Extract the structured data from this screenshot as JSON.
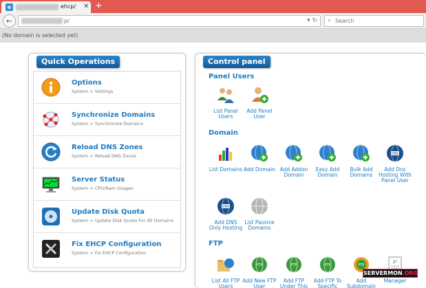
{
  "browser": {
    "tab_title": "ehcp/",
    "url_text": "p/",
    "search_placeholder": "Search"
  },
  "domain_status": "(No domain is selected yet)",
  "quick_operations": {
    "title": "Quick Operations",
    "items": [
      {
        "name": "Options",
        "path": "System > Settings",
        "icon": "options-info-icon"
      },
      {
        "name": "Synchronize Domains",
        "path": "System > Synchronize Domains",
        "icon": "network-sync-icon"
      },
      {
        "name": "Reload DNS Zones",
        "path": "System > Reload DNS Zones",
        "icon": "reload-icon"
      },
      {
        "name": "Server Status",
        "path": "System > CPU/Ram Usages",
        "icon": "monitor-icon"
      },
      {
        "name": "Update Disk Quota",
        "path": "System > Update Disk Quota For All Domains",
        "icon": "disk-icon"
      },
      {
        "name": "Fix EHCP Configuration",
        "path": "System > Fix EHCP Configuration",
        "icon": "tools-icon"
      }
    ]
  },
  "control_panel": {
    "title": "Control panel",
    "sections": {
      "panel_users": {
        "label": "Panel Users",
        "items": [
          {
            "label": "List Panel Users",
            "icon": "users-icon"
          },
          {
            "label": "Add Panel User",
            "icon": "add-user-icon"
          }
        ]
      },
      "domain": {
        "label": "Domain",
        "items": [
          {
            "label": "List Domains",
            "icon": "bar-chart-icon"
          },
          {
            "label": "Add Domain",
            "icon": "globe-add-icon"
          },
          {
            "label": "Add Addon Domain",
            "icon": "globe-add-icon"
          },
          {
            "label": "Easy Add Domain",
            "icon": "globe-add-icon"
          },
          {
            "label": "Bulk Add Domains",
            "icon": "globe-add-icon"
          },
          {
            "label": "Add Dns Hosting With Panel User",
            "icon": "dns-globe-icon"
          },
          {
            "label": "Add DNS Only Hosting",
            "icon": "dns-globe-icon"
          },
          {
            "label": "List Passive Domains",
            "icon": "grey-globe-icon"
          }
        ]
      },
      "ftp": {
        "label": "FTP",
        "items": [
          {
            "label": "List All FTP Users",
            "icon": "folder-globe-icon"
          },
          {
            "label": "Add New FTP User",
            "icon": "ftp-globe-icon"
          },
          {
            "label": "Add FTP Under This Panel",
            "icon": "ftp-globe-icon"
          },
          {
            "label": "Add FTP To Specific Domain",
            "icon": "ftp-globe-icon"
          },
          {
            "label": "Add Subdomain With FTP",
            "icon": "ftp-globe-icon"
          },
          {
            "label": "Manager",
            "icon": "doc-icon"
          }
        ]
      }
    }
  },
  "watermark": {
    "part1": "SERVERMON",
    "part2": ".ORG"
  },
  "colors": {
    "accent": "#1e7cc0",
    "tabbar": "#e05a4f",
    "title_bar": "#11589a"
  }
}
